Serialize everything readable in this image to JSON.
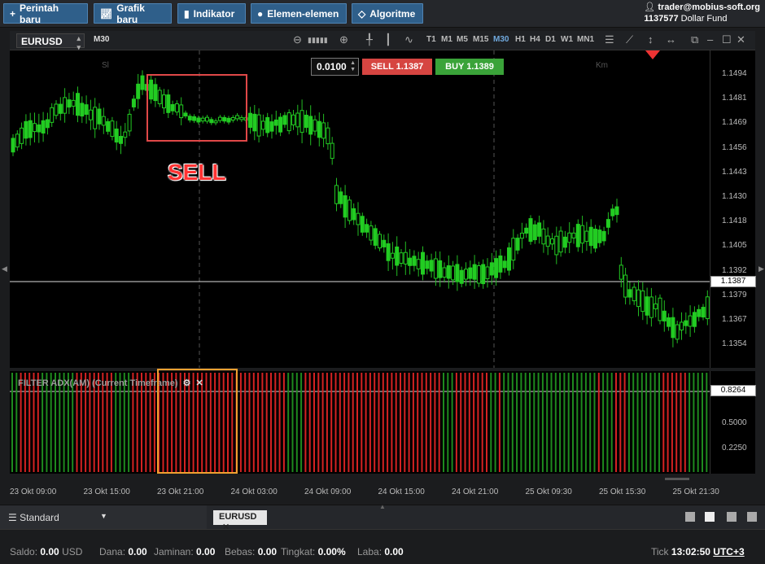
{
  "toolbar": {
    "new_order": "Perintah baru",
    "new_chart": "Grafik baru",
    "indicator": "Indikator",
    "elements": "Elemen-elemen",
    "algorithm": "Algoritme"
  },
  "account": {
    "user": "trader@mobius-soft.org",
    "number": "1137577",
    "fund": "Dollar Fund"
  },
  "chart": {
    "symbol": "EURUSD",
    "timeframe": "M30",
    "timeframes": [
      "T1",
      "M1",
      "M5",
      "M15",
      "M30",
      "H1",
      "H4",
      "D1",
      "W1",
      "MN1"
    ],
    "active_timeframe": "M30",
    "session_labels": [
      "Sl",
      "Km"
    ],
    "lot": "0.0100",
    "sell_label": "SELL 1.1387",
    "buy_label": "BUY 1.1389",
    "annotation": "SELL",
    "price_ticks": [
      "1.1494",
      "1.1481",
      "1.1469",
      "1.1456",
      "1.1443",
      "1.1430",
      "1.1418",
      "1.1405",
      "1.1392",
      "1.1379",
      "1.1367",
      "1.1354"
    ],
    "current_price": "1.1387",
    "indicator_title": "FILTER ADX(AM) (Current Timeframe)",
    "indicator_ticks": [
      "0.8264",
      "0.5000",
      "0.2250"
    ],
    "time_ticks": [
      "23 Okt 09:00",
      "23 Okt 15:00",
      "23 Okt 21:00",
      "24 Okt 03:00",
      "24 Okt 09:00",
      "24 Okt 15:00",
      "24 Okt 21:00",
      "25 Okt 09:30",
      "25 Okt 15:30",
      "25 Okt 21:30"
    ],
    "colors": {
      "up": "#22cc22",
      "down": "#22cc22",
      "sell": "#d64541",
      "buy": "#3aa339",
      "bar_red": "#d42222",
      "bar_green": "#1e8a1e"
    }
  },
  "tabs": {
    "workspace": "Standard",
    "symbol_tab": "EURUSD"
  },
  "status": {
    "saldo_label": "Saldo:",
    "saldo_value": "0.00",
    "saldo_unit": "USD",
    "dana_label": "Dana:",
    "dana_value": "0.00",
    "jaminan_label": "Jaminan:",
    "jaminan_value": "0.00",
    "bebas_label": "Bebas:",
    "bebas_value": "0.00",
    "tingkat_label": "Tingkat:",
    "tingkat_value": "0.00%",
    "laba_label": "Laba:",
    "laba_value": "0.00",
    "tick_label": "Tick",
    "time": "13:02:50",
    "tz": "UTC+3"
  }
}
